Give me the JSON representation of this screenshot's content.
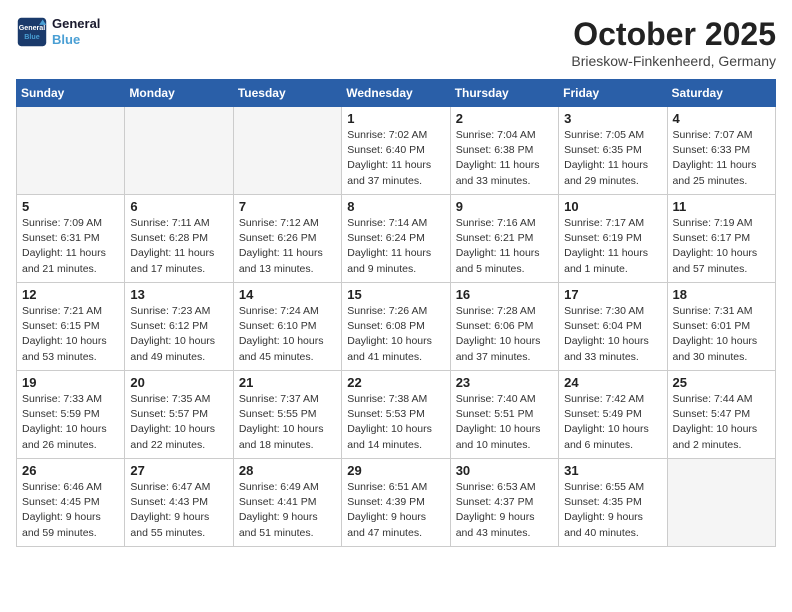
{
  "header": {
    "logo_line1": "General",
    "logo_line2": "Blue",
    "month": "October 2025",
    "location": "Brieskow-Finkenheerd, Germany"
  },
  "weekdays": [
    "Sunday",
    "Monday",
    "Tuesday",
    "Wednesday",
    "Thursday",
    "Friday",
    "Saturday"
  ],
  "weeks": [
    [
      {
        "day": "",
        "info": ""
      },
      {
        "day": "",
        "info": ""
      },
      {
        "day": "",
        "info": ""
      },
      {
        "day": "1",
        "info": "Sunrise: 7:02 AM\nSunset: 6:40 PM\nDaylight: 11 hours and 37 minutes."
      },
      {
        "day": "2",
        "info": "Sunrise: 7:04 AM\nSunset: 6:38 PM\nDaylight: 11 hours and 33 minutes."
      },
      {
        "day": "3",
        "info": "Sunrise: 7:05 AM\nSunset: 6:35 PM\nDaylight: 11 hours and 29 minutes."
      },
      {
        "day": "4",
        "info": "Sunrise: 7:07 AM\nSunset: 6:33 PM\nDaylight: 11 hours and 25 minutes."
      }
    ],
    [
      {
        "day": "5",
        "info": "Sunrise: 7:09 AM\nSunset: 6:31 PM\nDaylight: 11 hours and 21 minutes."
      },
      {
        "day": "6",
        "info": "Sunrise: 7:11 AM\nSunset: 6:28 PM\nDaylight: 11 hours and 17 minutes."
      },
      {
        "day": "7",
        "info": "Sunrise: 7:12 AM\nSunset: 6:26 PM\nDaylight: 11 hours and 13 minutes."
      },
      {
        "day": "8",
        "info": "Sunrise: 7:14 AM\nSunset: 6:24 PM\nDaylight: 11 hours and 9 minutes."
      },
      {
        "day": "9",
        "info": "Sunrise: 7:16 AM\nSunset: 6:21 PM\nDaylight: 11 hours and 5 minutes."
      },
      {
        "day": "10",
        "info": "Sunrise: 7:17 AM\nSunset: 6:19 PM\nDaylight: 11 hours and 1 minute."
      },
      {
        "day": "11",
        "info": "Sunrise: 7:19 AM\nSunset: 6:17 PM\nDaylight: 10 hours and 57 minutes."
      }
    ],
    [
      {
        "day": "12",
        "info": "Sunrise: 7:21 AM\nSunset: 6:15 PM\nDaylight: 10 hours and 53 minutes."
      },
      {
        "day": "13",
        "info": "Sunrise: 7:23 AM\nSunset: 6:12 PM\nDaylight: 10 hours and 49 minutes."
      },
      {
        "day": "14",
        "info": "Sunrise: 7:24 AM\nSunset: 6:10 PM\nDaylight: 10 hours and 45 minutes."
      },
      {
        "day": "15",
        "info": "Sunrise: 7:26 AM\nSunset: 6:08 PM\nDaylight: 10 hours and 41 minutes."
      },
      {
        "day": "16",
        "info": "Sunrise: 7:28 AM\nSunset: 6:06 PM\nDaylight: 10 hours and 37 minutes."
      },
      {
        "day": "17",
        "info": "Sunrise: 7:30 AM\nSunset: 6:04 PM\nDaylight: 10 hours and 33 minutes."
      },
      {
        "day": "18",
        "info": "Sunrise: 7:31 AM\nSunset: 6:01 PM\nDaylight: 10 hours and 30 minutes."
      }
    ],
    [
      {
        "day": "19",
        "info": "Sunrise: 7:33 AM\nSunset: 5:59 PM\nDaylight: 10 hours and 26 minutes."
      },
      {
        "day": "20",
        "info": "Sunrise: 7:35 AM\nSunset: 5:57 PM\nDaylight: 10 hours and 22 minutes."
      },
      {
        "day": "21",
        "info": "Sunrise: 7:37 AM\nSunset: 5:55 PM\nDaylight: 10 hours and 18 minutes."
      },
      {
        "day": "22",
        "info": "Sunrise: 7:38 AM\nSunset: 5:53 PM\nDaylight: 10 hours and 14 minutes."
      },
      {
        "day": "23",
        "info": "Sunrise: 7:40 AM\nSunset: 5:51 PM\nDaylight: 10 hours and 10 minutes."
      },
      {
        "day": "24",
        "info": "Sunrise: 7:42 AM\nSunset: 5:49 PM\nDaylight: 10 hours and 6 minutes."
      },
      {
        "day": "25",
        "info": "Sunrise: 7:44 AM\nSunset: 5:47 PM\nDaylight: 10 hours and 2 minutes."
      }
    ],
    [
      {
        "day": "26",
        "info": "Sunrise: 6:46 AM\nSunset: 4:45 PM\nDaylight: 9 hours and 59 minutes."
      },
      {
        "day": "27",
        "info": "Sunrise: 6:47 AM\nSunset: 4:43 PM\nDaylight: 9 hours and 55 minutes."
      },
      {
        "day": "28",
        "info": "Sunrise: 6:49 AM\nSunset: 4:41 PM\nDaylight: 9 hours and 51 minutes."
      },
      {
        "day": "29",
        "info": "Sunrise: 6:51 AM\nSunset: 4:39 PM\nDaylight: 9 hours and 47 minutes."
      },
      {
        "day": "30",
        "info": "Sunrise: 6:53 AM\nSunset: 4:37 PM\nDaylight: 9 hours and 43 minutes."
      },
      {
        "day": "31",
        "info": "Sunrise: 6:55 AM\nSunset: 4:35 PM\nDaylight: 9 hours and 40 minutes."
      },
      {
        "day": "",
        "info": ""
      }
    ]
  ]
}
